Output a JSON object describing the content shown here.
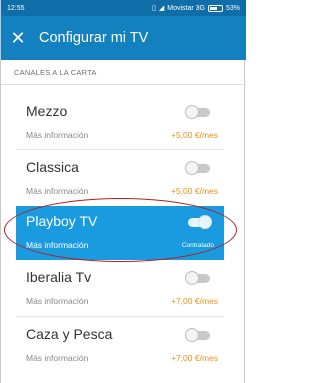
{
  "status_bar": {
    "time": "12:55",
    "carrier": "Movistar 3G",
    "battery": "53%"
  },
  "app_bar": {
    "title": "Configurar mi TV"
  },
  "section": {
    "header": "CANALES A LA CARTA"
  },
  "channels": [
    {
      "name": "Mezzo",
      "info": "Más información",
      "price": "+5,00 €/mes",
      "enabled": false
    },
    {
      "name": "Classica",
      "info": "Más información",
      "price": "+5,00 €/mes",
      "enabled": false
    },
    {
      "name": "Playboy TV",
      "info": "Más información",
      "status": "Contratado",
      "enabled": true
    },
    {
      "name": "Iberalia Tv",
      "info": "Más información",
      "price": "+7,00 €/mes",
      "enabled": false
    },
    {
      "name": "Caza y Pesca",
      "info": "Más información",
      "price": "+7,00 €/mes",
      "enabled": false
    }
  ],
  "colors": {
    "status_bar": "#0f6ea8",
    "app_bar": "#1380c0",
    "selected_row": "#1a9be0",
    "price": "#f0901a",
    "annotation": "#b0211d"
  }
}
